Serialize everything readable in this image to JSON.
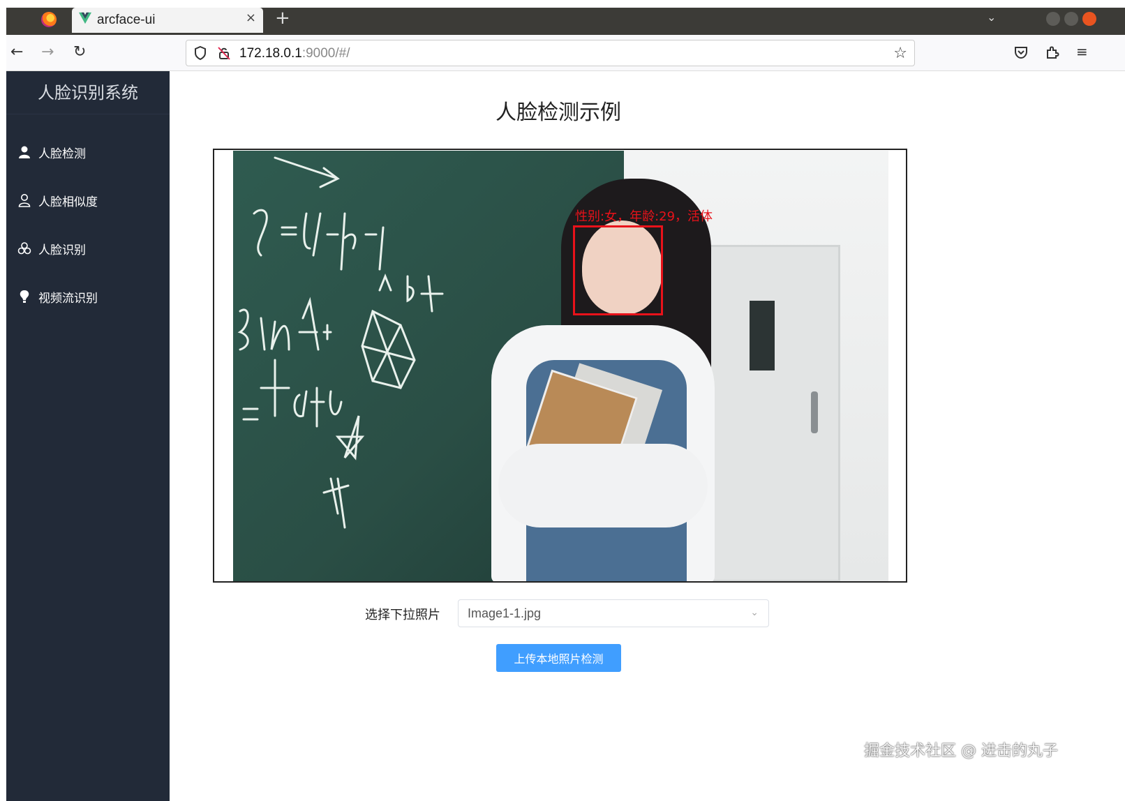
{
  "browser": {
    "tab_title": "arcface-ui",
    "tab_close": "×",
    "new_tab": "+",
    "url_host": "172.18.0.1",
    "url_rest": ":9000/#/"
  },
  "sidebar": {
    "title": "人脸识别系统",
    "items": [
      {
        "label": "人脸检测",
        "icon": "user-filled-icon"
      },
      {
        "label": "人脸相似度",
        "icon": "user-outline-icon"
      },
      {
        "label": "人脸识别",
        "icon": "circles-icon"
      },
      {
        "label": "视频流识别",
        "icon": "bulb-icon"
      }
    ]
  },
  "main": {
    "title": "人脸检测示例",
    "face_label": "性别:女，年龄:29，活体",
    "select_label": "选择下拉照片",
    "select_value": "Image1-1.jpg",
    "upload_button": "上传本地照片检测"
  },
  "colors": {
    "sidebar_bg": "#222a38",
    "primary": "#409eff",
    "face_box": "#e8121a"
  },
  "watermark": "掘金技术社区 @ 进击的丸子"
}
